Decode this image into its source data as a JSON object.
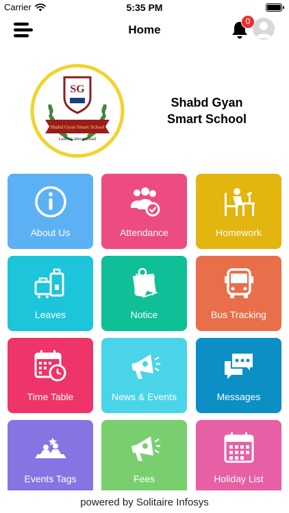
{
  "status_bar": {
    "carrier": "Carrier",
    "time": "5:35 PM"
  },
  "nav": {
    "title": "Home",
    "notification_count": "0"
  },
  "school": {
    "name_line1": "Shabd Gyan",
    "name_line2": "Smart School",
    "logo_initials": "SG",
    "logo_banner": "Shabd Gyan Smart School",
    "logo_motto": "Learn.Labour.Lead"
  },
  "tiles": [
    {
      "label": "About Us",
      "icon": "info-icon",
      "color": "#5cb1f5"
    },
    {
      "label": "Attendance",
      "icon": "attendance-icon",
      "color": "#ec4c7f"
    },
    {
      "label": "Homework",
      "icon": "homework-icon",
      "color": "#e2b50f"
    },
    {
      "label": "Leaves",
      "icon": "luggage-icon",
      "color": "#1cc5d9"
    },
    {
      "label": "Notice",
      "icon": "notice-icon",
      "color": "#0fbf97"
    },
    {
      "label": "Bus Tracking",
      "icon": "bus-icon",
      "color": "#e96f4a"
    },
    {
      "label": "Time Table",
      "icon": "calendar-clock-icon",
      "color": "#ee3468"
    },
    {
      "label": "News & Events",
      "icon": "megaphone-icon",
      "color": "#4ad4ea"
    },
    {
      "label": "Messages",
      "icon": "chat-icon",
      "color": "#0b8fc4"
    },
    {
      "label": "Events Tags",
      "icon": "event-icon",
      "color": "#8774e3"
    },
    {
      "label": "Fees",
      "icon": "megaphone-icon",
      "color": "#79cf6e"
    },
    {
      "label": "Holiday List",
      "icon": "calendar-icon",
      "color": "#e75fa4"
    }
  ],
  "footer": {
    "text": "powered by Solitaire Infosys"
  }
}
